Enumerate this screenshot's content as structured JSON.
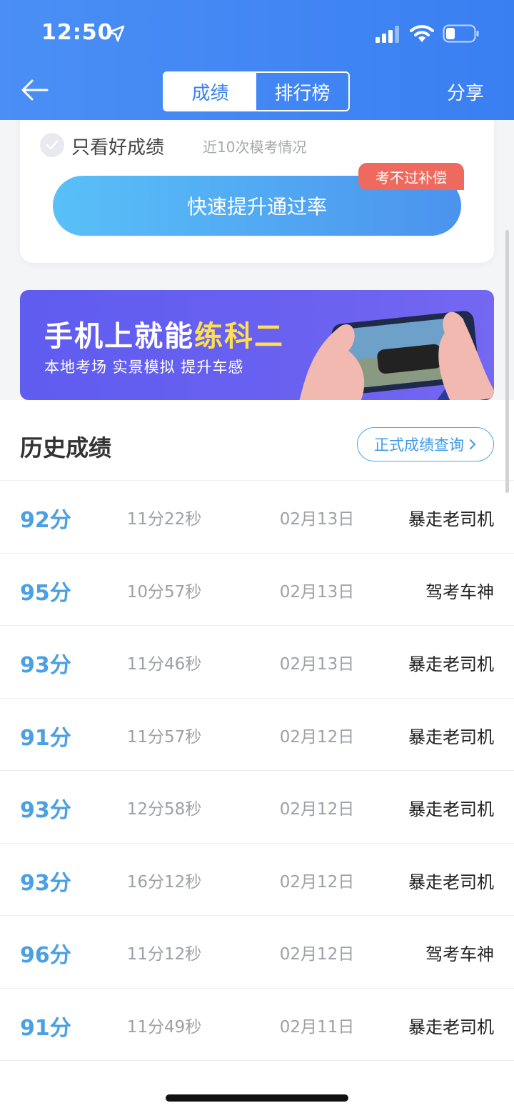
{
  "status": {
    "time": "12:50"
  },
  "header": {
    "tabs": [
      {
        "label": "成绩",
        "active": true
      },
      {
        "label": "排行榜",
        "active": false
      }
    ],
    "share_label": "分享"
  },
  "filter": {
    "label": "只看好成绩",
    "subtext": "近10次模考情况"
  },
  "boost": {
    "label": "快速提升通过率",
    "badge": "考不过补偿"
  },
  "banner": {
    "title_prefix": "手机上就能",
    "title_highlight": "练科二",
    "subtitle": "本地考场 实景模拟 提升车感"
  },
  "history": {
    "title": "历史成绩",
    "query_label": "正式成绩查询",
    "rows": [
      {
        "score": "92分",
        "duration": "11分22秒",
        "date": "02月13日",
        "title": "暴走老司机"
      },
      {
        "score": "95分",
        "duration": "10分57秒",
        "date": "02月13日",
        "title": "驾考车神"
      },
      {
        "score": "93分",
        "duration": "11分46秒",
        "date": "02月13日",
        "title": "暴走老司机"
      },
      {
        "score": "91分",
        "duration": "11分57秒",
        "date": "02月12日",
        "title": "暴走老司机"
      },
      {
        "score": "93分",
        "duration": "12分58秒",
        "date": "02月12日",
        "title": "暴走老司机"
      },
      {
        "score": "93分",
        "duration": "16分12秒",
        "date": "02月12日",
        "title": "暴走老司机"
      },
      {
        "score": "96分",
        "duration": "11分12秒",
        "date": "02月12日",
        "title": "驾考车神"
      },
      {
        "score": "91分",
        "duration": "11分49秒",
        "date": "02月11日",
        "title": "暴走老司机"
      }
    ]
  },
  "colors": {
    "header": "#3b82f2",
    "score": "#4b9fe3",
    "badge": "#ef6a5e",
    "banner_highlight": "#ffe04c"
  },
  "icons": [
    "navigation-arrow-icon",
    "signal-icon",
    "wifi-icon",
    "battery-icon",
    "back-arrow-icon",
    "check-icon",
    "chevron-right-icon"
  ]
}
